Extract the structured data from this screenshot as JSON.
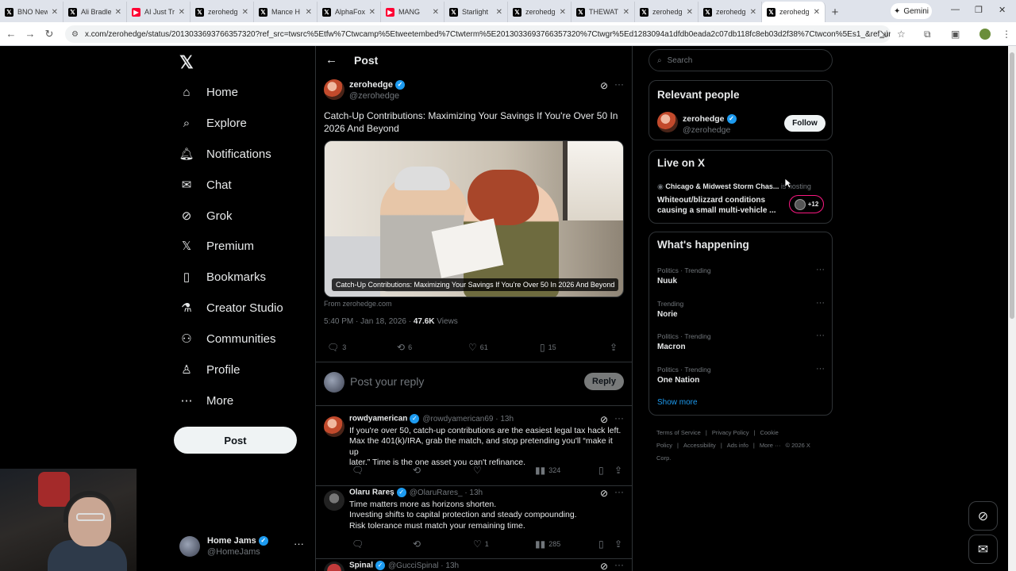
{
  "browser": {
    "tabs": [
      {
        "label": "BNO New",
        "favicon": "x"
      },
      {
        "label": "Ali Bradle",
        "favicon": "x"
      },
      {
        "label": "AI Just Tr",
        "favicon": "youtube"
      },
      {
        "label": "zerohedg",
        "favicon": "x"
      },
      {
        "label": "Mance H",
        "favicon": "x"
      },
      {
        "label": "AlphaFox",
        "favicon": "x"
      },
      {
        "label": "MANG",
        "favicon": "youtube"
      },
      {
        "label": "Starlight",
        "favicon": "x"
      },
      {
        "label": "zerohedg",
        "favicon": "x"
      },
      {
        "label": "THEWAT",
        "favicon": "x"
      },
      {
        "label": "zerohedg",
        "favicon": "x"
      },
      {
        "label": "zerohedg",
        "favicon": "x"
      },
      {
        "label": "zerohedg",
        "favicon": "x",
        "active": true
      }
    ],
    "gemini_label": "Gemini",
    "url": "x.com/zerohedge/status/2013033693766357320?ref_src=twsrc%5Etfw%7Ctwcamp%5Etweetembed%7Ctwterm%5E2013033693766357320%7Ctwgr%5Ed1283094a1dfdb0eada2c07db118fc8eb03d2f38%7Ctwcon%5Es1_&ref_url=http%3A%2F..."
  },
  "nav": {
    "items": [
      {
        "label": "Home",
        "icon": "home-icon"
      },
      {
        "label": "Explore",
        "icon": "search-icon"
      },
      {
        "label": "Notifications",
        "icon": "bell-icon"
      },
      {
        "label": "Chat",
        "icon": "mail-icon"
      },
      {
        "label": "Grok",
        "icon": "grok-icon"
      },
      {
        "label": "Premium",
        "icon": "x-premium-icon"
      },
      {
        "label": "Bookmarks",
        "icon": "bookmark-icon"
      },
      {
        "label": "Creator Studio",
        "icon": "flask-icon"
      },
      {
        "label": "Communities",
        "icon": "people-icon"
      },
      {
        "label": "Profile",
        "icon": "person-icon"
      },
      {
        "label": "More",
        "icon": "more-circle-icon"
      }
    ],
    "post_label": "Post",
    "account": {
      "name": "Home Jams",
      "handle": "@HomeJams"
    }
  },
  "main": {
    "header_title": "Post",
    "post": {
      "author": "zerohedge",
      "handle": "@zerohedge",
      "text": "Catch-Up Contributions: Maximizing Your Savings If You're Over 50 In 2026 And Beyond",
      "card_caption": "Catch-Up Contributions: Maximizing Your Savings If You're Over 50 In 2026 And Beyond",
      "card_source": "From zerohedge.com",
      "time": "5:40 PM · Jan 18, 2026 · ",
      "views_count": "47.6K",
      "views_label": " Views",
      "replies": "3",
      "reposts": "6",
      "likes": "61",
      "bookmarks": "15"
    },
    "reply_box": {
      "placeholder": "Post your reply",
      "button": "Reply"
    },
    "comments": [
      {
        "name": "rowdyamerican",
        "handle": "@rowdyamerican69 · 13h",
        "lines": [
          "If you're over 50, catch-up contributions are the easiest legal tax hack left.",
          "Max the 401(k)/IRA, grab the match, and stop pretending you'll “make it up",
          "later.” Time is the one asset you can't refinance."
        ],
        "replies": "",
        "reposts": "",
        "likes": "",
        "views": "324"
      },
      {
        "name": "Olaru Rareș",
        "handle": "@OlaruRares_ · 13h",
        "lines": [
          "Time matters more as horizons shorten.",
          "Investing shifts to capital protection and steady compounding.",
          "Risk tolerance must match your remaining time."
        ],
        "replies": "",
        "reposts": "",
        "likes": "1",
        "views": "285"
      },
      {
        "name": "Spinal",
        "handle": "@GucciSpinal · 13h",
        "lines": []
      }
    ]
  },
  "right": {
    "search_placeholder": "Search",
    "relevant_title": "Relevant people",
    "relevant_person": {
      "name": "zerohedge",
      "handle": "@zerohedge",
      "follow": "Follow"
    },
    "live_title": "Live on X",
    "live": {
      "host": "Chicago & Midwest Storm Chas...",
      "host_suffix": " is hosting",
      "title": "Whiteout/blizzard conditions causing a small multi-vehicle ...",
      "count": "+12"
    },
    "happening_title": "What's happening",
    "trends": [
      {
        "context": "Politics · Trending",
        "name": "Nuuk"
      },
      {
        "context": "Trending",
        "name": "Norie"
      },
      {
        "context": "Politics · Trending",
        "name": "Macron"
      },
      {
        "context": "Politics · Trending",
        "name": "One Nation"
      }
    ],
    "show_more": "Show more",
    "footer": [
      "Terms of Service",
      "|",
      "Privacy Policy",
      "|",
      "Cookie Policy",
      "|",
      "Accessibility",
      "|",
      "Ads info",
      "|",
      "More ···",
      "© 2026 X Corp."
    ]
  },
  "colors": {
    "accent": "#1d9bf0",
    "live_ring": "#f91880",
    "background": "#000000"
  }
}
